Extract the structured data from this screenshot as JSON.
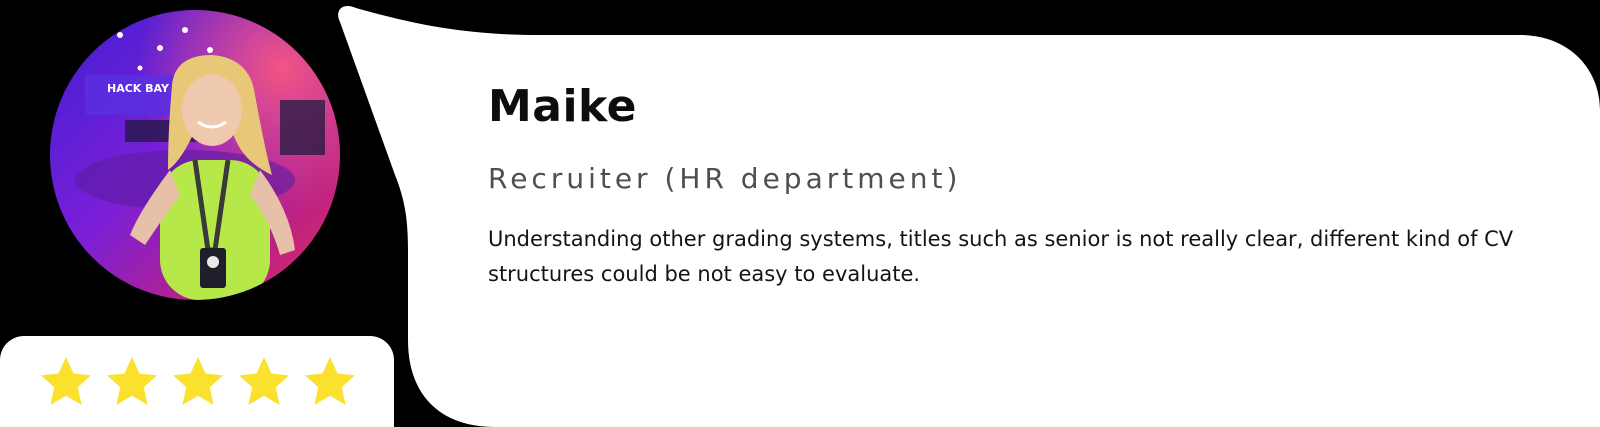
{
  "testimonial": {
    "name": "Maike",
    "role": "Recruiter (HR department)",
    "quote": "Understanding other grading systems, titles such as senior is not really clear, different kind of CV structures could be not easy to evaluate.",
    "rating": 5,
    "rating_max": 5
  },
  "photo": {
    "sign_text": "HACK BAY"
  },
  "colors": {
    "background": "#000000",
    "card": "#ffffff",
    "star": "#f9e12e",
    "name": "#0d0d0d",
    "role": "#4f4f4f",
    "quote": "#141414"
  },
  "icons": {
    "rating": "star-icon"
  }
}
